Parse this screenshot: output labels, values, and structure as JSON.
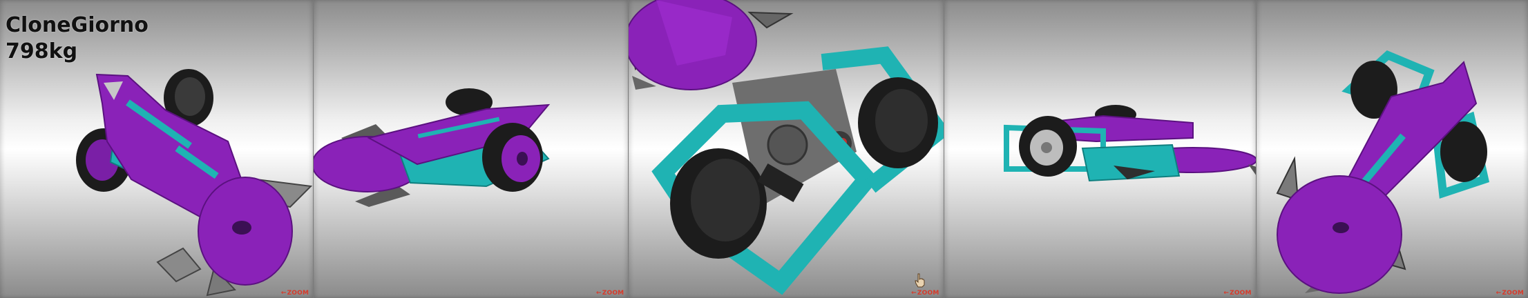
{
  "robot": {
    "name": "CloneGiorno",
    "weight": "798kg"
  },
  "views": [
    {
      "id": "view-1",
      "zoom_label": "ZOOM"
    },
    {
      "id": "view-2",
      "zoom_label": "ZOOM"
    },
    {
      "id": "view-3",
      "zoom_label": "ZOOM"
    },
    {
      "id": "view-4",
      "zoom_label": "ZOOM"
    },
    {
      "id": "view-5",
      "zoom_label": "ZOOM"
    }
  ],
  "colors": {
    "body_purple": "#8a22b8",
    "frame_cyan": "#1fb3b3",
    "wheel_dark": "#1c1c1c",
    "blade_steel": "#8a8a8a",
    "zoom_red": "#d83a2a"
  },
  "icons": [
    "hand-cursor-icon"
  ]
}
